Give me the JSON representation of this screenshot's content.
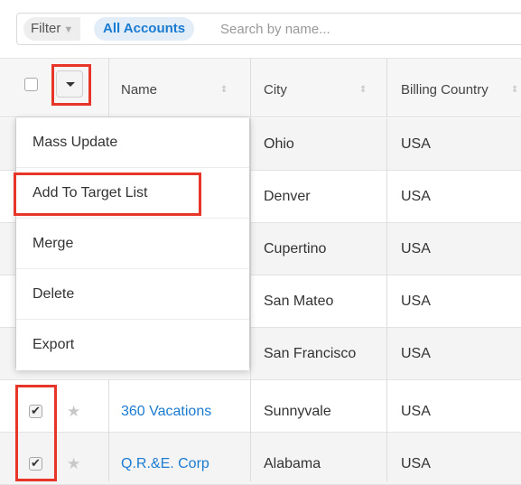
{
  "filter": {
    "filter_label": "Filter",
    "filter_caret": "▼",
    "active_pill": "All Accounts",
    "search_placeholder": "Search by name..."
  },
  "table": {
    "columns": [
      {
        "label": "Name",
        "sort_icon": "⇕"
      },
      {
        "label": "City",
        "sort_icon": "⇕"
      },
      {
        "label": "Billing Country",
        "sort_icon": "⇕"
      }
    ],
    "rows": [
      {
        "name": "",
        "city": "Ohio",
        "country": "USA",
        "checked": false
      },
      {
        "name": "",
        "city": "Denver",
        "country": "USA",
        "checked": false
      },
      {
        "name": "",
        "city": "Cupertino",
        "country": "USA",
        "checked": false
      },
      {
        "name": "",
        "city": "San Mateo",
        "country": "USA",
        "checked": false
      },
      {
        "name": "",
        "city": "San Francisco",
        "country": "USA",
        "checked": false
      },
      {
        "name": "360 Vacations",
        "city": "Sunnyvale",
        "country": "USA",
        "checked": true
      },
      {
        "name": "Q.R.&E. Corp",
        "city": "Alabama",
        "country": "USA",
        "checked": true
      }
    ]
  },
  "menu": {
    "items": [
      "Mass Update",
      "Add To Target List",
      "Merge",
      "Delete",
      "Export"
    ]
  },
  "icons": {
    "star": "★"
  },
  "colors": {
    "link": "#1b7bd0",
    "highlight": "#e8352a",
    "pill_bg": "#e2edf8"
  }
}
